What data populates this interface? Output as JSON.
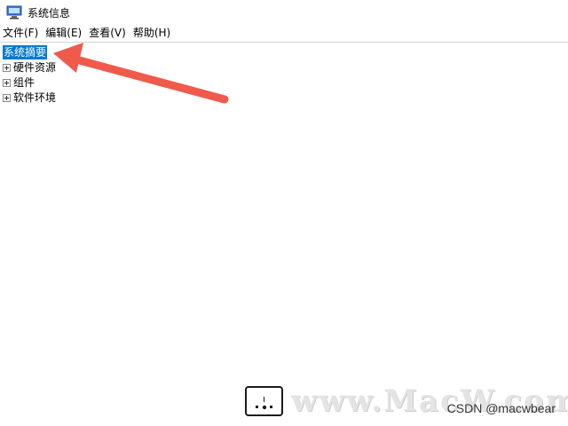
{
  "window": {
    "title": "系统信息",
    "icon": "system-info-icon"
  },
  "menubar": {
    "items": [
      {
        "label": "文件(F)"
      },
      {
        "label": "编辑(E)"
      },
      {
        "label": "查看(V)"
      },
      {
        "label": "帮助(H)"
      }
    ]
  },
  "tree": {
    "items": [
      {
        "label": "系统摘要",
        "expandable": false,
        "selected": true
      },
      {
        "label": "硬件资源",
        "expandable": true,
        "selected": false
      },
      {
        "label": "组件",
        "expandable": true,
        "selected": false
      },
      {
        "label": "软件环境",
        "expandable": true,
        "selected": false
      }
    ]
  },
  "annotation": {
    "type": "arrow",
    "color": "#f05a4a",
    "points_to": "系统摘要"
  },
  "watermark": {
    "text": "www.MacW.com",
    "credit": "CSDN @macwbear"
  },
  "colors": {
    "selection": "#0078d7",
    "arrow": "#f05a4a"
  }
}
